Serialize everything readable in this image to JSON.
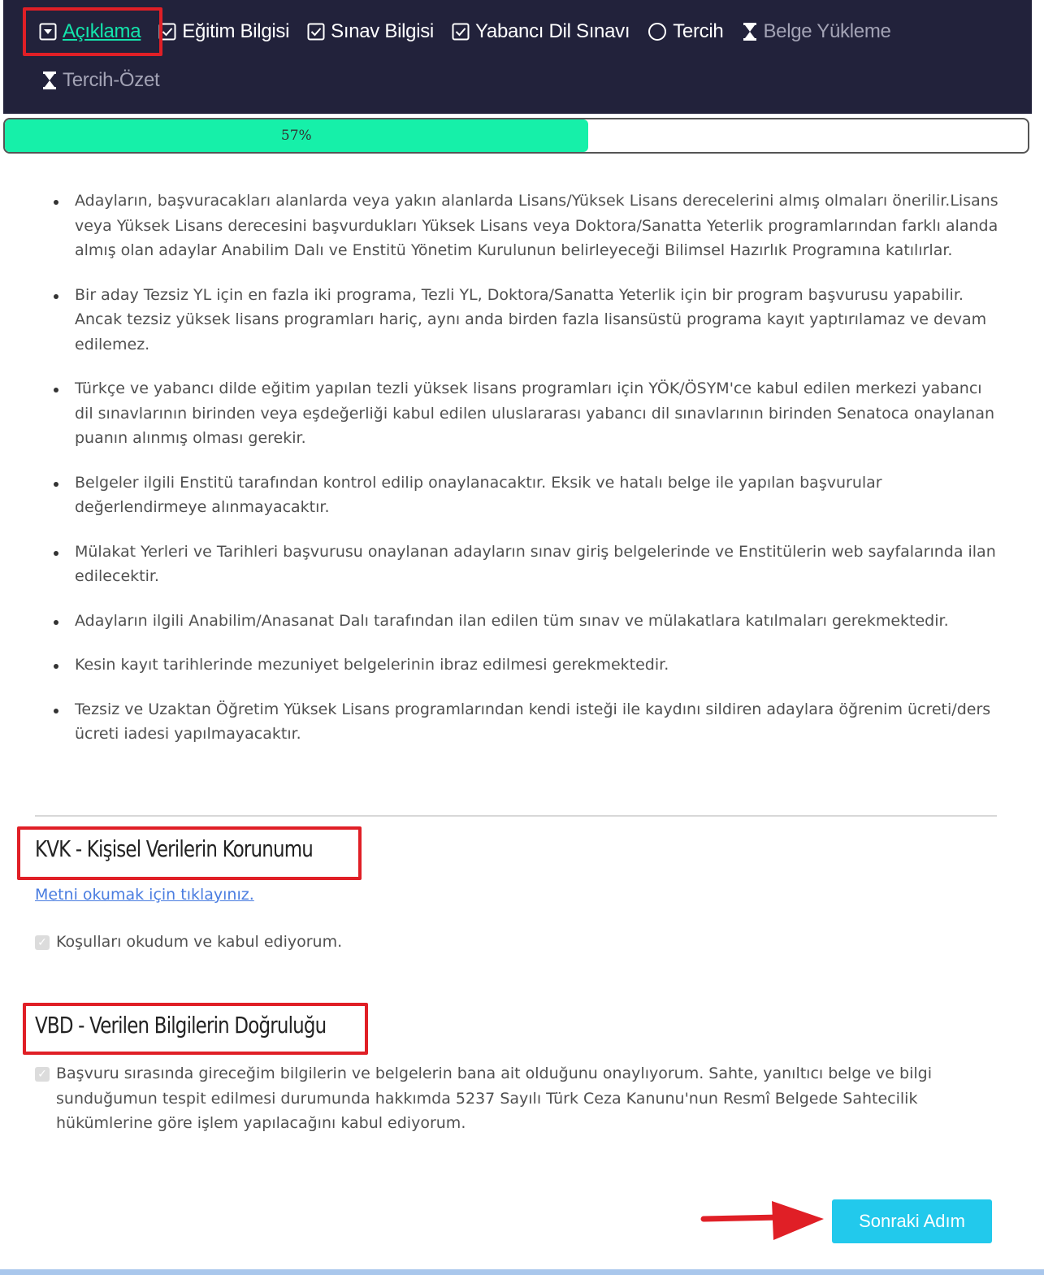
{
  "nav": {
    "items": [
      {
        "label": "Açıklama",
        "state": "active",
        "icon": "chevron-down-square-icon"
      },
      {
        "label": "Eğitim Bilgisi",
        "state": "done",
        "icon": "check-square-icon"
      },
      {
        "label": "Sınav Bilgisi",
        "state": "done",
        "icon": "check-square-icon"
      },
      {
        "label": "Yabancı Dil Sınavı",
        "state": "done",
        "icon": "check-square-icon"
      },
      {
        "label": "Tercih",
        "state": "current",
        "icon": "circle-icon"
      },
      {
        "label": "Belge Yükleme",
        "state": "pending",
        "icon": "hourglass-icon"
      },
      {
        "label": "Tercih-Özet",
        "state": "pending",
        "icon": "hourglass-icon"
      }
    ]
  },
  "progress": {
    "value": 57,
    "label": "57%"
  },
  "info": {
    "items": [
      "Adayların, başvuracakları alanlarda veya yakın alanlarda Lisans/Yüksek Lisans derecelerini almış olmaları önerilir.Lisans veya Yüksek Lisans derecesini başvurdukları Yüksek Lisans veya Doktora/Sanatta Yeterlik programlarından farklı alanda almış olan adaylar Anabilim Dalı ve Enstitü Yönetim Kurulunun belirleyeceği Bilimsel Hazırlık Programına katılırlar.",
      "Bir aday Tezsiz YL için en fazla iki programa, Tezli YL, Doktora/Sanatta Yeterlik için bir program başvurusu yapabilir. Ancak tezsiz yüksek lisans programları hariç, aynı anda birden fazla lisansüstü programa kayıt yaptırılamaz ve devam edilemez.",
      "Türkçe ve yabancı dilde eğitim yapılan tezli yüksek lisans programları için YÖK/ÖSYM'ce kabul edilen merkezi yabancı dil sınavlarının birinden veya eşdeğerliği kabul edilen uluslararası yabancı dil sınavlarının birinden Senatoca onaylanan puanın alınmış olması gerekir.",
      "Belgeler ilgili Enstitü tarafından kontrol edilip onaylanacaktır. Eksik ve hatalı belge ile yapılan başvurular değerlendirmeye alınmayacaktır.",
      "Mülakat Yerleri ve Tarihleri başvurusu onaylanan adayların sınav giriş belgelerinde ve Enstitülerin web sayfalarında ilan edilecektir.",
      "Adayların ilgili Anabilim/Anasanat Dalı tarafından ilan edilen tüm sınav ve mülakatlara katılmaları gerekmektedir.",
      "Kesin kayıt tarihlerinde mezuniyet belgelerinin ibraz edilmesi gerekmektedir.",
      "Tezsiz ve Uzaktan Öğretim Yüksek Lisans programlarından kendi isteği ile kaydını sildiren adaylara öğrenim ücreti/ders ücreti iadesi yapılmayacaktır."
    ]
  },
  "kvk": {
    "title": "KVK - Kişisel Verilerin Korunumu",
    "link": "Metni okumak için tıklayınız.",
    "checkbox_label": "Koşulları okudum ve kabul ediyorum.",
    "checked": true
  },
  "vbd": {
    "title": "VBD - Verilen Bilgilerin Doğruluğu",
    "checkbox_label": "Başvuru sırasında gireceğim bilgilerin ve belgelerin bana ait olduğunu onaylıyorum. Sahte, yanıltıcı belge ve bilgi sunduğumun tespit edilmesi durumunda hakkımda 5237 Sayılı Türk Ceza Kanunu'nun Resmî Belgede Sahtecilik hükümlerine göre işlem yapılacağını kabul ediyorum.",
    "checked": true
  },
  "actions": {
    "next_label": "Sonraki Adım"
  },
  "colors": {
    "nav_bg": "#22223b",
    "active": "#13e5ac",
    "progress": "#16f0a9",
    "button": "#22c9ec",
    "highlight": "#e01f26"
  }
}
